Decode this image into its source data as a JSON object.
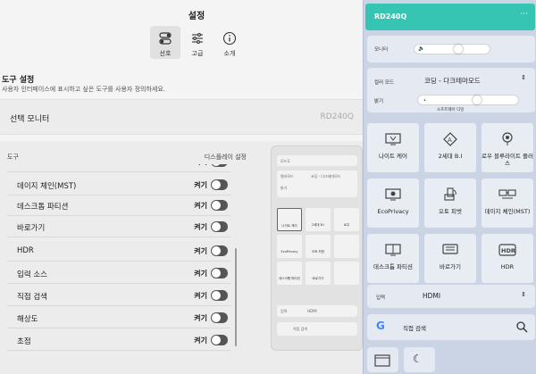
{
  "settings": {
    "title": "설정",
    "tabs": [
      {
        "label": "선호",
        "icon": "toggle-icon"
      },
      {
        "label": "고급",
        "icon": "sliders-icon"
      },
      {
        "label": "소개",
        "icon": "info-icon"
      }
    ],
    "section_title": "도구 설정",
    "section_desc": "사용자 인터페이스에 표시하고 싶은 도구를 사용자 정의하세요.",
    "monitor_label": "선택 모니터",
    "monitor_value": "RD240Q",
    "list_header_left": "도구",
    "list_header_right": "디스플레이 설정",
    "on_label": "켜기",
    "rows": [
      "데이지 체인(MST)",
      "데스크톱 파티션",
      "바로가기",
      "HDR",
      "입력 소스",
      "직접 검색",
      "해상도",
      "초점"
    ]
  },
  "preview": {
    "r1": "모드도",
    "r2a": "컬러모드",
    "r2b": "코딩 - 다크테마모드",
    "r2c": "밝기",
    "tiles": [
      "나이트 케어",
      "2세대 B.I",
      "로우",
      "EcoPrivacy",
      "오토 피벗",
      "",
      "데스크톱 파티션",
      "바로가기",
      ""
    ],
    "input_label": "입력",
    "input_value": "HDMI",
    "search": "직접 검색"
  },
  "quick": {
    "device": "RD240Q",
    "menu": "···",
    "volume_label": "모니터",
    "volume_level": 0.6,
    "color_mode_label": "컬러 모드",
    "color_mode_value": "코딩 - 다크테마모드",
    "brightness_label": "밝기",
    "brightness_level": 0.6,
    "brightness_sub": "소프트웨어 디밍",
    "tiles": [
      {
        "label": "나이트 케어",
        "icon": "night-care-icon"
      },
      {
        "label": "2세대 B.I",
        "icon": "brightness-intelligence-icon"
      },
      {
        "label": "로우 블루라이트 플러스",
        "icon": "low-blue-light-icon"
      },
      {
        "label": "EcoPrivacy",
        "icon": "eco-privacy-icon"
      },
      {
        "label": "오토 피벗",
        "icon": "auto-pivot-icon"
      },
      {
        "label": "데이지 체인(MST)",
        "icon": "daisy-chain-icon"
      },
      {
        "label": "데스크톱 파티션",
        "icon": "desktop-partition-icon"
      },
      {
        "label": "바로가기",
        "icon": "shortcut-icon"
      },
      {
        "label": "HDR",
        "icon": "hdr-icon"
      }
    ],
    "input_label": "입력",
    "input_value": "HDMI",
    "search_label": "직접 검색"
  },
  "colors": {
    "accent": "#36c5b3",
    "panel": "#cad4e4"
  }
}
